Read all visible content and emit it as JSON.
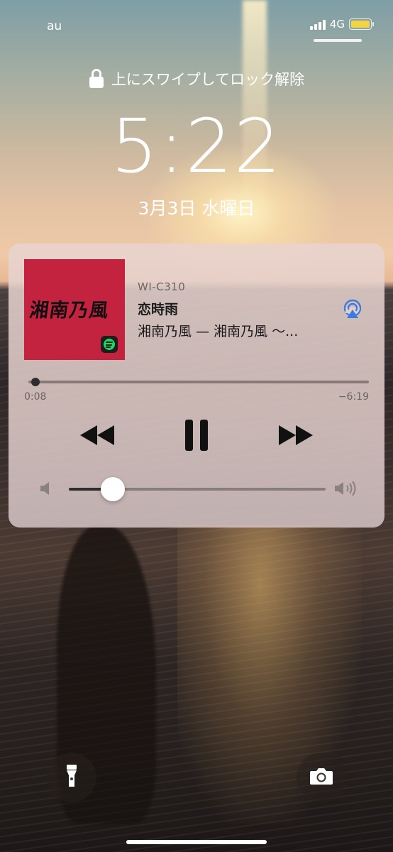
{
  "status_bar": {
    "carrier": "au",
    "network": "4G",
    "battery_color": "#f4d443"
  },
  "lock_screen": {
    "unlock_hint": "上にスワイプしてロック解除",
    "time": "5:22",
    "date": "3月3日 水曜日"
  },
  "now_playing": {
    "artwork_text": "湘南乃風",
    "artwork_color": "#c4233f",
    "device": "WI-C310",
    "title": "恋時雨",
    "artist_album": "湘南乃風 — 湘南乃風 〜...",
    "elapsed": "0:08",
    "remaining": "−6:19",
    "progress_fraction": 0.02,
    "volume_fraction": 0.17,
    "icons": [
      "spotify-icon",
      "airplay-icon",
      "rewind-icon",
      "pause-icon",
      "fast-forward-icon",
      "volume-low-icon",
      "volume-high-icon"
    ]
  },
  "bottom": {
    "icons": [
      "flashlight-icon",
      "camera-icon"
    ]
  }
}
